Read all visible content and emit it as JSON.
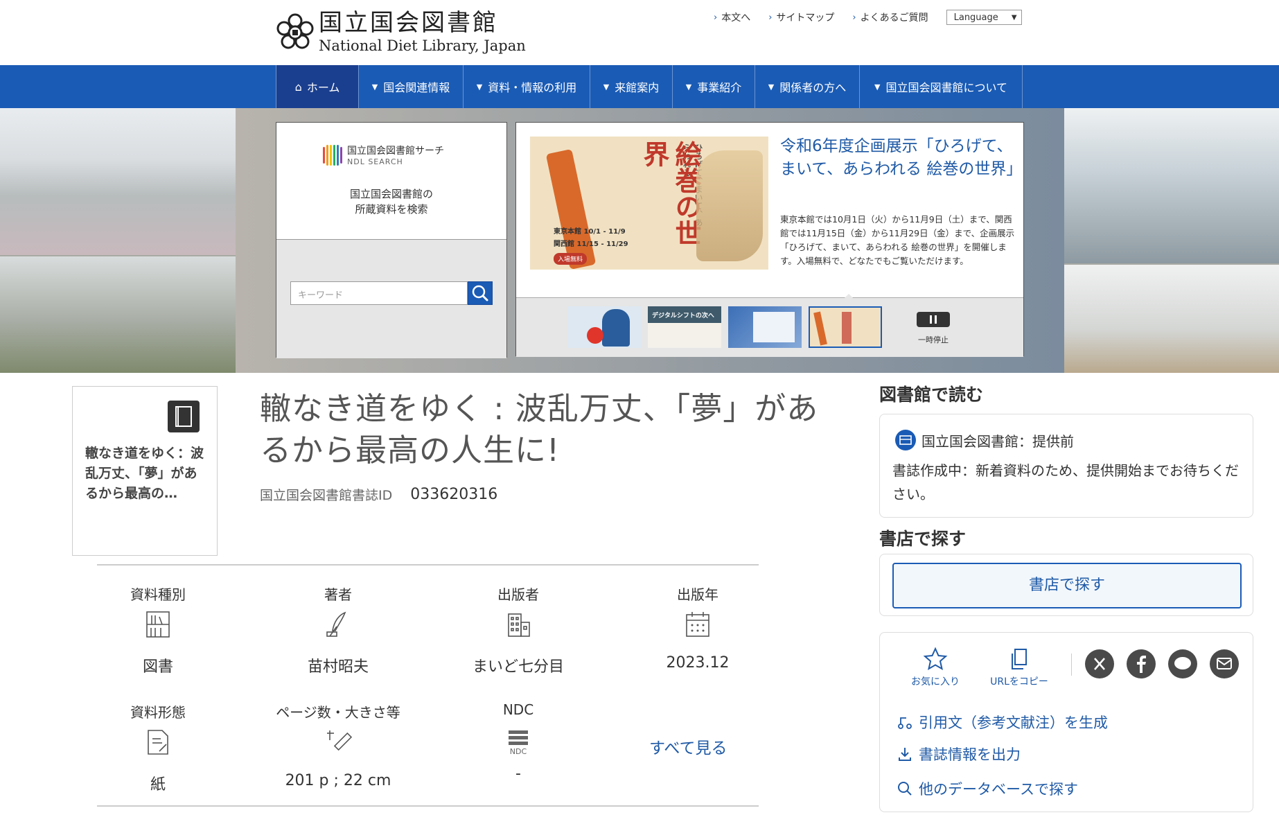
{
  "header": {
    "logo_ja": "国立国会図書館",
    "logo_en": "National Diet Library, Japan",
    "util_links": [
      "本文へ",
      "サイトマップ",
      "よくあるご質問"
    ],
    "language": "Language"
  },
  "nav": {
    "items": [
      "ホーム",
      "国会関連情報",
      "資料・情報の利用",
      "来館案内",
      "事業紹介",
      "関係者の方へ",
      "国立国会図書館について"
    ]
  },
  "ndl_search": {
    "logo_ja": "国立国会図書館サーチ",
    "logo_en": "NDL SEARCH",
    "desc_line1": "国立国会図書館の",
    "desc_line2": "所蔵資料を検索",
    "placeholder": "キーワード"
  },
  "news": {
    "title": "令和6年度企画展示「ひろげて、まいて、あらわれる 絵巻の世界」",
    "desc": "東京本館では10月1日（火）から11月9日（土）まで、関西館では11月15日（金）から11月29日（金）まで、企画展示「ひろげて、まいて、あらわれる 絵巻の世界」を開催します。入場無料で、どなたでもご覧いただけます。",
    "poster_big": "絵巻の世界",
    "poster_small": "ひろげて、まいて、あらわれる",
    "poster_dates1": "東京本館 10/1 - 11/9",
    "poster_dates2": "関西館 11/15 - 11/29",
    "poster_free": "入場無料",
    "thumb2_text": "デジタルシフトの次へ",
    "pause_label": "一時停止"
  },
  "book": {
    "cover_title": "轍なき道をゆく：波乱万丈、「夢」があるから最高の…",
    "title": "轍なき道をゆく : 波乱万丈、「夢」があるから最高の人生に!",
    "id_label": "国立国会図書館書誌ID",
    "id_value": "033620316",
    "meta": [
      {
        "label": "資料種別",
        "value": "図書",
        "icon": "bookshelf-icon"
      },
      {
        "label": "著者",
        "value": "苗村昭夫",
        "icon": "quill-icon"
      },
      {
        "label": "出版者",
        "value": "まいど七分目",
        "icon": "building-icon"
      },
      {
        "label": "出版年",
        "value": "2023.12",
        "icon": "calendar-icon"
      },
      {
        "label": "資料形態",
        "value": "紙",
        "icon": "paper-icon"
      },
      {
        "label": "ページ数・大きさ等",
        "value": "201 p ; 22 cm",
        "icon": "ruler-icon"
      },
      {
        "label": "NDC",
        "value": "-",
        "icon": "ndc-icon",
        "icon_text": "NDC"
      }
    ],
    "see_all": "すべて見る"
  },
  "right": {
    "read_heading": "図書館で読む",
    "library_name": "国立国会図書館：提供前",
    "library_status": "書誌作成中：新着資料のため、提供開始までお待ちください。",
    "store_heading": "書店で探す",
    "store_button": "書店で探す",
    "favorite": "お気に入り",
    "copy_url": "URLをコピー",
    "links": [
      "引用文（参考文献注）を生成",
      "書誌情報を出力",
      "他のデータベースで探す"
    ]
  }
}
